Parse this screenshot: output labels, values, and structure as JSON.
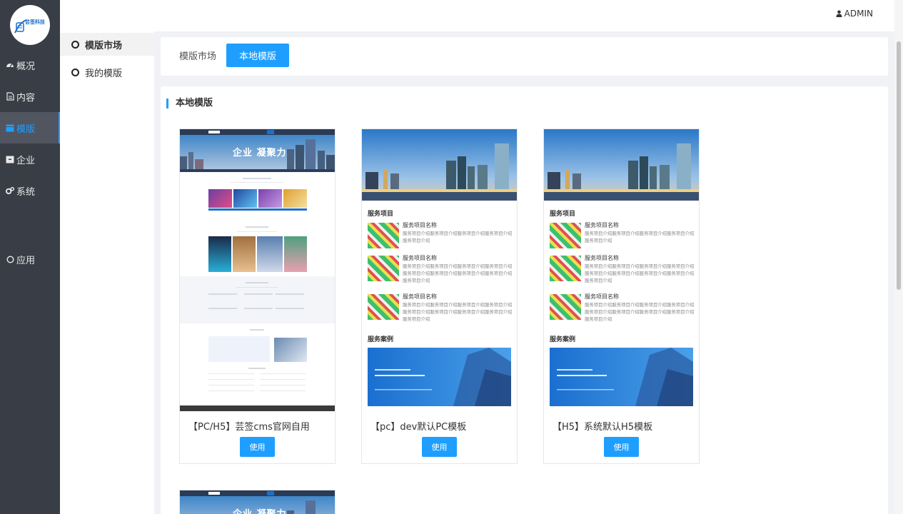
{
  "logo": {
    "name": "芸签科技"
  },
  "sidebar": {
    "items": [
      {
        "label": "概况",
        "icon": "dashboard-icon"
      },
      {
        "label": "内容",
        "icon": "document-icon"
      },
      {
        "label": "模版",
        "icon": "template-icon",
        "active": true
      },
      {
        "label": "企业",
        "icon": "enterprise-icon"
      },
      {
        "label": "系统",
        "icon": "gears-icon"
      },
      {
        "label": "应用",
        "icon": "circle-icon"
      }
    ]
  },
  "subnav": {
    "items": [
      {
        "label": "模版市场",
        "active": true
      },
      {
        "label": "我的模版",
        "active": false
      }
    ]
  },
  "header": {
    "user": "ADMIN",
    "user_icon": "user-icon"
  },
  "tabs": [
    {
      "label": "模版市场",
      "active": false
    },
    {
      "label": "本地模版",
      "active": true
    }
  ],
  "section": {
    "title": "本地模版"
  },
  "templates": [
    {
      "name": "【PC/H5】芸签cms官网自用",
      "use_label": "使用",
      "hero_text": "企业 凝聚力"
    },
    {
      "name": "【pc】dev默认PC模板",
      "use_label": "使用",
      "services_heading": "服务项目",
      "cases_heading": "服务案例",
      "service_title": "服务项目名称",
      "service_descs": [
        "服务项目介绍服务项目介绍服务项目介绍服务项目介绍服务项目介绍",
        "服务项目介绍服务项目介绍服务项目介绍服务项目介绍服务项目介绍服务项目介绍服务项目介绍服务项目介绍服务项目介绍",
        "服务项目介绍服务项目介绍服务项目介绍服务项目介绍服务项目介绍服务项目介绍服务项目介绍服务项目介绍服务项目介绍"
      ]
    },
    {
      "name": "【H5】系统默认H5模板",
      "use_label": "使用",
      "services_heading": "服务项目",
      "cases_heading": "服务案例",
      "service_title": "服务项目名称",
      "service_descs": [
        "服务项目介绍服务项目介绍服务项目介绍服务项目介绍服务项目介绍",
        "服务项目介绍服务项目介绍服务项目介绍服务项目介绍服务项目介绍服务项目介绍服务项目介绍服务项目介绍服务项目介绍",
        "服务项目介绍服务项目介绍服务项目介绍服务项目介绍服务项目介绍服务项目介绍服务项目介绍服务项目介绍服务项目介绍"
      ]
    }
  ],
  "partial_template": {
    "hero_text": "企业 凝聚力"
  },
  "colors": {
    "accent": "#1e9fff",
    "sidebar_bg": "#393d46",
    "sidebar_active": "#515560"
  }
}
